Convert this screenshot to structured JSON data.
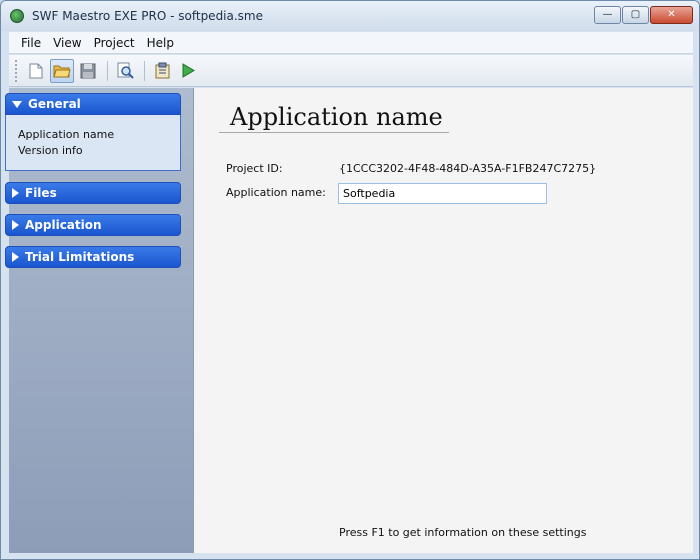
{
  "window": {
    "title": "SWF Maestro EXE PRO - softpedia.sme",
    "minimize_label": "—",
    "maximize_label": "▢",
    "close_label": "✕"
  },
  "menu": {
    "items": [
      {
        "label": "File"
      },
      {
        "label": "View"
      },
      {
        "label": "Project"
      },
      {
        "label": "Help"
      }
    ]
  },
  "toolbar": {
    "icons": [
      "new-icon",
      "open-folder-icon",
      "save-icon",
      "preview-icon",
      "clipboard-icon",
      "run-icon"
    ]
  },
  "sidebar": {
    "sections": [
      {
        "label": "General",
        "expanded": true,
        "items": [
          "Application name",
          "Version info"
        ]
      },
      {
        "label": "Files",
        "expanded": false
      },
      {
        "label": "Application",
        "expanded": false
      },
      {
        "label": "Trial Limitations",
        "expanded": false
      }
    ]
  },
  "content": {
    "heading": "Application name",
    "project_id_label": "Project ID:",
    "project_id_value": "{1CCC3202-4F48-484D-A35A-F1FB247C7275}",
    "app_name_label": "Application name:",
    "app_name_value": "Softpedia",
    "help_text": "Press F1 to get information on these settings"
  },
  "colors": {
    "section_header": "#2a66dd",
    "panel_bg": "#99a9c2",
    "content_bg": "#f4f4f4"
  }
}
